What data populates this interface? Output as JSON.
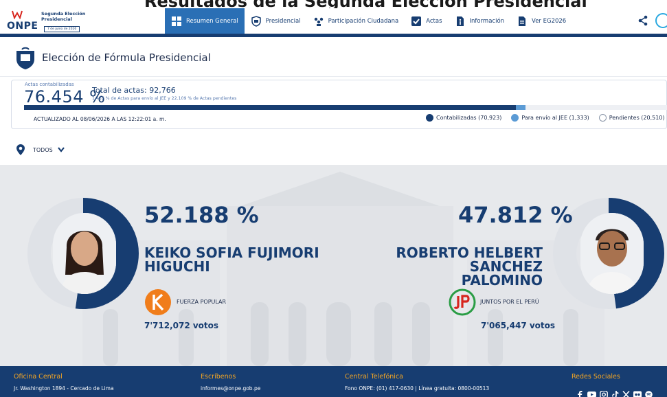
{
  "header": {
    "cut_heading": "Resultados de la Segunda Elección Presidencial",
    "logo": {
      "name": "ONPE",
      "line1": "Segunda Elección",
      "line2": "Presidencial",
      "date": "7 de junio de 2026"
    },
    "nav": [
      {
        "label": "Resumen General",
        "icon": "grid-icon",
        "active": true
      },
      {
        "label": "Presidencial",
        "icon": "shield-icon",
        "active": false
      },
      {
        "label": "Participación Ciudadana",
        "icon": "people-icon",
        "active": false
      },
      {
        "label": "Actas",
        "icon": "check-icon",
        "active": false
      },
      {
        "label": "Información",
        "icon": "info-doc-icon",
        "active": false
      },
      {
        "label": "Ver EG2026",
        "icon": "document-icon",
        "active": false
      }
    ]
  },
  "page": {
    "title": "Elección de Fórmula Presidencial"
  },
  "progress": {
    "label": "Actas contabilizadas",
    "percent": "76.454 %",
    "total": "Total de actas: 92,766",
    "detail": "1.437 % de Actas para envío al JEE y 22.109 % de Actas pendientes",
    "contabilizadas_fraction": 0.76454,
    "jee_fraction": 0.01437,
    "updated": "ACTUALIZADO AL 08/06/2026 A LAS 12:22:01 a. m.",
    "legend": [
      {
        "label": "Contabilizadas (70,923)",
        "color": "#173d71"
      },
      {
        "label": "Para envío al JEE (1,333)",
        "color": "#5b9bd5"
      },
      {
        "label": "Pendientes (20,510)",
        "color": "#ffffff"
      }
    ]
  },
  "filter": {
    "label": "TODOS"
  },
  "candidates": [
    {
      "percent": "52.188 %",
      "share": 0.52188,
      "name_line1": "KEIKO SOFIA FUJIMORI",
      "name_line2": "HIGUCHI",
      "party": "FUERZA POPULAR",
      "votes": "7'712,072 votos"
    },
    {
      "percent": "47.812 %",
      "share": 0.47812,
      "name_line1": "ROBERTO HELBERT SANCHEZ",
      "name_line2": "PALOMINO",
      "party": "JUNTOS POR EL PERÚ",
      "votes": "7'065,447 votos"
    }
  ],
  "footer": {
    "office": {
      "title": "Oficina Central",
      "value": "Jr. Washington 1894 - Cercado de Lima"
    },
    "email": {
      "title": "Escríbenos",
      "value": "informes@onpe.gob.pe"
    },
    "phone": {
      "title": "Central Telefónica",
      "value": "Fono ONPE: (01) 417-0630 | Línea gratuita: 0800-00513"
    },
    "social": {
      "title": "Redes Sociales"
    }
  },
  "colors": {
    "navy": "#173d71",
    "blue": "#2a6fb5",
    "light_blue": "#5b9bd5",
    "orange": "#f5a623"
  }
}
